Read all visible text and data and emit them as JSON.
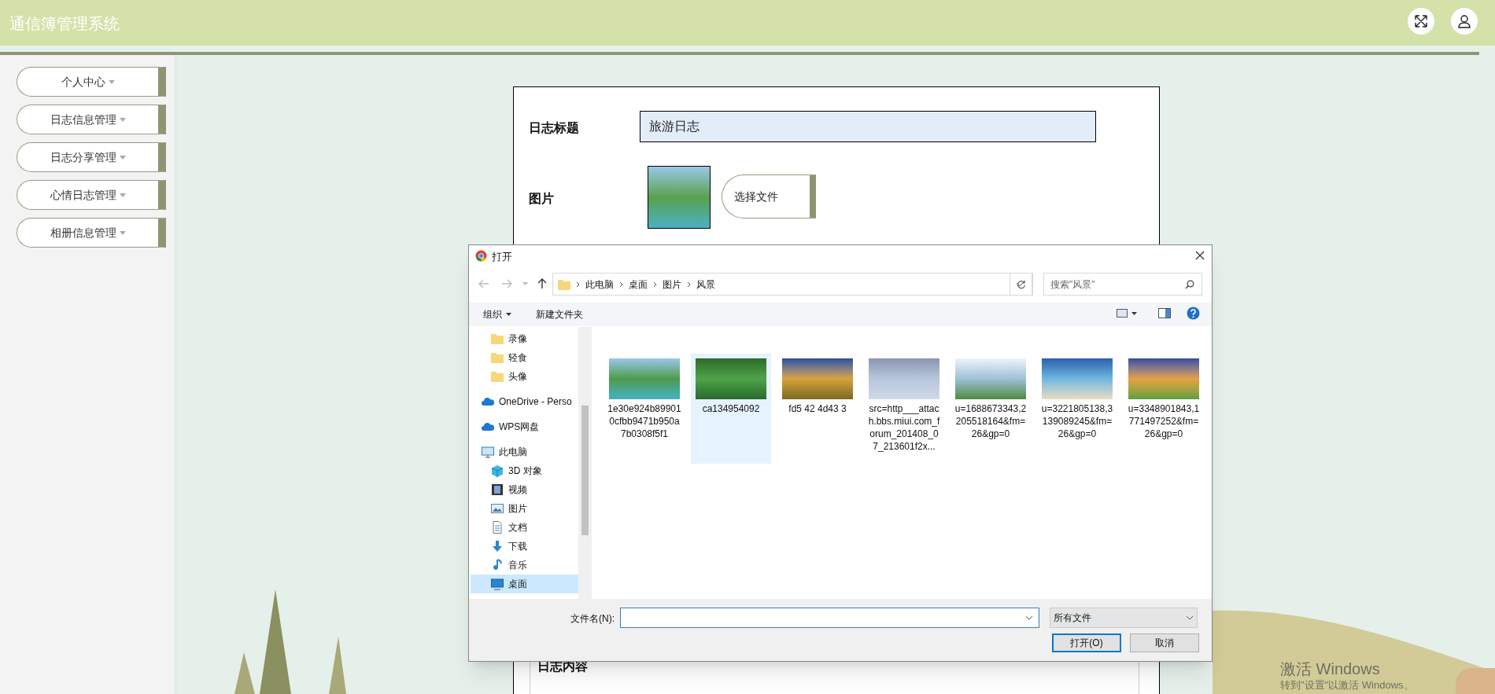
{
  "header": {
    "title": "通信簿管理系统"
  },
  "sidebar": {
    "items": [
      {
        "label": "个人中心"
      },
      {
        "label": "日志信息管理"
      },
      {
        "label": "日志分享管理"
      },
      {
        "label": "心情日志管理"
      },
      {
        "label": "相册信息管理"
      }
    ]
  },
  "form": {
    "fields": [
      {
        "kind": "text",
        "label": "日志标题",
        "value": "旅游日志"
      },
      {
        "kind": "image",
        "label": "图片",
        "button": "选择文件"
      }
    ],
    "content_label": "日志内容"
  },
  "dialog": {
    "title": "打开",
    "path": [
      "此电脑",
      "桌面",
      "图片",
      "风景"
    ],
    "search_placeholder": "搜索\"风景\"",
    "toolbar": {
      "organize": "组织",
      "new_folder": "新建文件夹"
    },
    "nav_tree": [
      {
        "children": [
          {
            "kind": "folder",
            "label": "录像",
            "selected": false
          },
          {
            "kind": "folder",
            "label": "轻食",
            "selected": false
          },
          {
            "kind": "folder",
            "label": "头像",
            "selected": false
          }
        ]
      },
      {
        "kind": "cloud",
        "label": "OneDrive - Perso",
        "selected": false
      },
      {
        "kind": "cloud",
        "label": "WPS网盘",
        "selected": false
      },
      {
        "kind": "pc",
        "label": "此电脑",
        "selected": false,
        "children": [
          {
            "kind": "cube",
            "label": "3D 对象",
            "selected": false
          },
          {
            "kind": "video",
            "label": "视频",
            "selected": false
          },
          {
            "kind": "picture",
            "label": "图片",
            "selected": false
          },
          {
            "kind": "doc",
            "label": "文档",
            "selected": false
          },
          {
            "kind": "download",
            "label": "下载",
            "selected": false
          },
          {
            "kind": "music",
            "label": "音乐",
            "selected": false
          },
          {
            "kind": "desktop",
            "label": "桌面",
            "selected": true
          }
        ]
      }
    ],
    "files": [
      {
        "name": "1e30e924b899010cfbb9471b950a7b0308f5f1",
        "selected": false
      },
      {
        "name": "ca134954092",
        "selected": true
      },
      {
        "name": "fd5 42 4d43 3",
        "selected": false
      },
      {
        "name": "src=http___attach.bbs.miui.com_forum_201408_07_213601f2x...",
        "selected": false
      },
      {
        "name": "u=1688673343,2205518164&fm=26&gp=0",
        "selected": false
      },
      {
        "name": "u=3221805138,3139089245&fm=26&gp=0",
        "selected": false
      },
      {
        "name": "u=3348901843,1771497252&fm=26&gp=0",
        "selected": false
      }
    ],
    "filename_label": "文件名(N):",
    "filter": "所有文件",
    "buttons": [
      {
        "label": "打开(O)",
        "primary": true
      },
      {
        "label": "取消",
        "primary": false
      }
    ]
  },
  "os_notice": {
    "title": "激活 Windows",
    "subtitle": "转到\"设置\"以激活 Windows。"
  }
}
